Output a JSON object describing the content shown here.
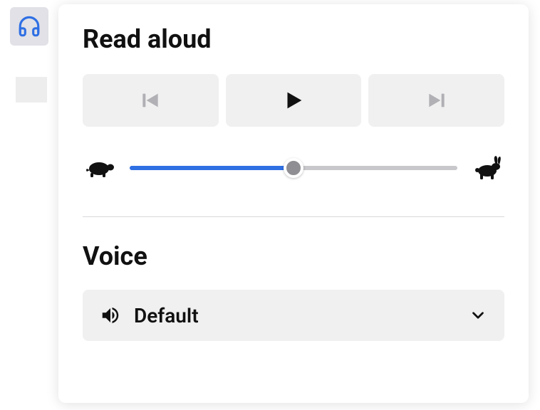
{
  "panel": {
    "title": "Read aloud"
  },
  "playback": {
    "previous": "previous",
    "play": "play",
    "next": "next"
  },
  "speed": {
    "value_percent": 50,
    "slow_icon": "turtle",
    "fast_icon": "rabbit"
  },
  "voice_section": {
    "title": "Voice",
    "selected": "Default"
  },
  "colors": {
    "accent": "#2f6fe4",
    "button_bg": "#f0f0f0",
    "slider_track": "#c7c7cc",
    "thumb": "#8e8e93"
  }
}
